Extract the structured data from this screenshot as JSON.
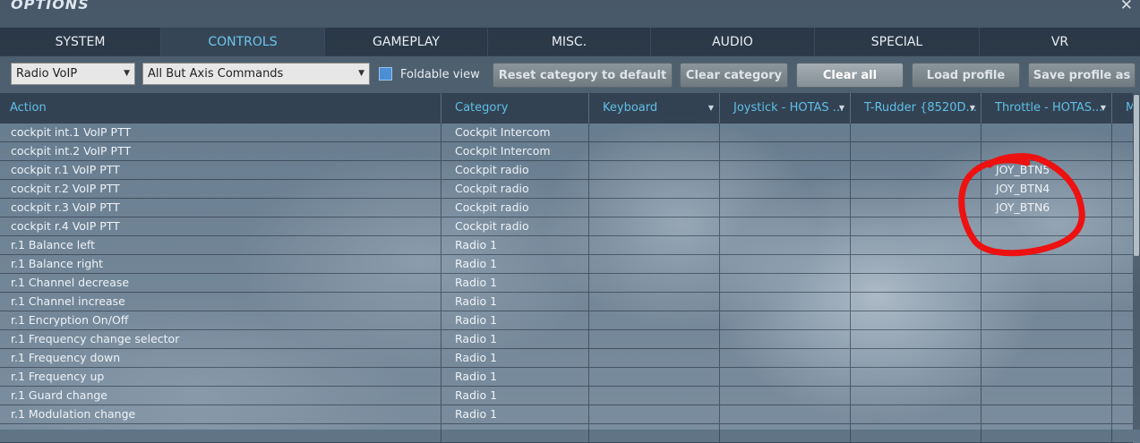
{
  "window": {
    "title": "OPTIONS",
    "close_glyph": "✕"
  },
  "tabs": [
    {
      "label": "SYSTEM",
      "active": false
    },
    {
      "label": "CONTROLS",
      "active": true
    },
    {
      "label": "GAMEPLAY",
      "active": false
    },
    {
      "label": "MISC.",
      "active": false
    },
    {
      "label": "AUDIO",
      "active": false
    },
    {
      "label": "SPECIAL",
      "active": false
    },
    {
      "label": "VR",
      "active": false
    }
  ],
  "toolbar": {
    "aircraft_select": "Radio VoIP",
    "filter_select": "All But Axis Commands",
    "foldable_view_label": "Foldable view",
    "foldable_view_checked": true,
    "reset_label": "Reset category to default",
    "clear_category_label": "Clear category",
    "clear_all_label": "Clear all",
    "load_profile_label": "Load profile",
    "save_profile_label": "Save profile as"
  },
  "columns": {
    "action": "Action",
    "category": "Category",
    "keyboard": "Keyboard",
    "joystick": "Joystick - HOTAS ...",
    "rudder": "T-Rudder {8520D...",
    "throttle": "Throttle - HOTAS...",
    "more": "M"
  },
  "rows": [
    {
      "action": "cockpit int.1 VoIP PTT",
      "category": "Cockpit Intercom",
      "throttle": ""
    },
    {
      "action": "cockpit int.2 VoIP PTT",
      "category": "Cockpit Intercom",
      "throttle": ""
    },
    {
      "action": "cockpit r.1 VoIP PTT",
      "category": "Cockpit radio",
      "throttle": "JOY_BTN5"
    },
    {
      "action": "cockpit r.2 VoIP PTT",
      "category": "Cockpit radio",
      "throttle": "JOY_BTN4"
    },
    {
      "action": "cockpit r.3 VoIP PTT",
      "category": "Cockpit radio",
      "throttle": "JOY_BTN6"
    },
    {
      "action": "cockpit r.4 VoIP PTT",
      "category": "Cockpit radio",
      "throttle": ""
    },
    {
      "action": "r.1 Balance left",
      "category": "Radio 1",
      "throttle": ""
    },
    {
      "action": "r.1 Balance right",
      "category": "Radio 1",
      "throttle": ""
    },
    {
      "action": "r.1 Channel decrease",
      "category": "Radio 1",
      "throttle": ""
    },
    {
      "action": "r.1 Channel increase",
      "category": "Radio 1",
      "throttle": ""
    },
    {
      "action": "r.1 Encryption On/Off",
      "category": "Radio 1",
      "throttle": ""
    },
    {
      "action": "r.1 Frequency change selector",
      "category": "Radio 1",
      "throttle": ""
    },
    {
      "action": "r.1 Frequency down",
      "category": "Radio 1",
      "throttle": ""
    },
    {
      "action": "r.1 Frequency up",
      "category": "Radio 1",
      "throttle": ""
    },
    {
      "action": "r.1 Guard change",
      "category": "Radio 1",
      "throttle": ""
    },
    {
      "action": "r.1 Modulation change",
      "category": "Radio 1",
      "throttle": ""
    },
    {
      "action": "",
      "category": "",
      "throttle": ""
    }
  ],
  "icons": {
    "dropdown": "chevron-down-icon",
    "close": "close-icon",
    "annotation": "red-circle-annotation"
  },
  "colors": {
    "accent": "#6cc6ea",
    "header_text": "#5fbfe6",
    "checkbox": "#4a8fd6",
    "annotation": "#ee1111"
  }
}
